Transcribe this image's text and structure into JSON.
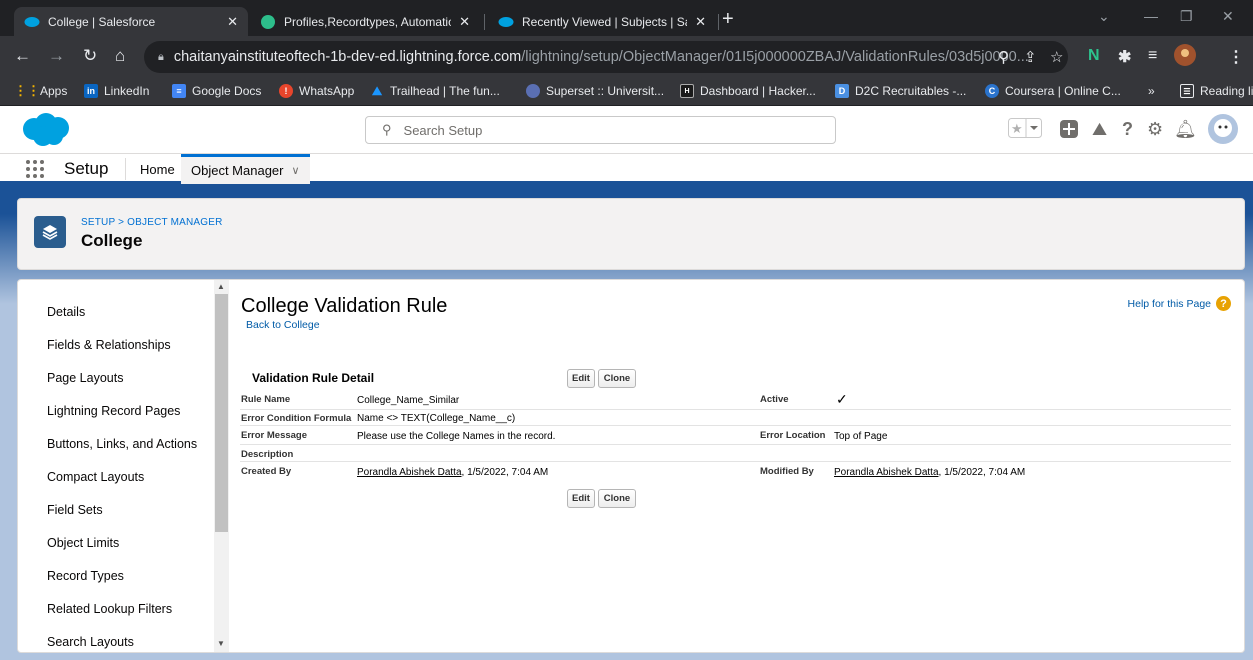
{
  "browser": {
    "tabs": [
      {
        "title": "College | Salesforce",
        "active": true
      },
      {
        "title": "Profiles,Recordtypes, Automation",
        "active": false
      },
      {
        "title": "Recently Viewed | Subjects | Sale",
        "active": false
      }
    ],
    "address": {
      "host": "chaitanyainstituteoftech-1b-dev-ed.lightning.force.com",
      "path": "/lightning/setup/ObjectManager/01I5j000000ZBAJ/ValidationRules/03d5j0000..."
    },
    "bookmarks": [
      {
        "label": "Apps",
        "icon": "apps-grid-icon",
        "color": "#f4b400"
      },
      {
        "label": "LinkedIn",
        "icon": "linkedin-icon",
        "color": "#0a66c2"
      },
      {
        "label": "Google Docs",
        "icon": "google-docs-icon",
        "color": "#4285f4"
      },
      {
        "label": "WhatsApp",
        "icon": "whatsapp-icon",
        "color": "#e8452c"
      },
      {
        "label": "Trailhead | The fun...",
        "icon": "trailhead-icon",
        "color": "#1b96ff"
      },
      {
        "label": "Superset :: Universit...",
        "icon": "superset-icon",
        "color": "#5a6fb3"
      },
      {
        "label": "Dashboard | Hacker...",
        "icon": "hackerrank-icon",
        "color": "#1a1a1a"
      },
      {
        "label": "D2C Recruitables -...",
        "icon": "d2c-icon",
        "color": "#4a90e2"
      },
      {
        "label": "Coursera | Online C...",
        "icon": "coursera-icon",
        "color": "#2a73cc"
      }
    ],
    "bookmarks_more": "»",
    "reading_list": "Reading list"
  },
  "sf_header": {
    "search_placeholder": "Search Setup"
  },
  "sf_nav": {
    "app_name": "Setup",
    "items": [
      {
        "label": "Home"
      },
      {
        "label": "Object Manager",
        "active": true
      }
    ]
  },
  "object_header": {
    "breadcrumb": "SETUP > OBJECT MANAGER",
    "title": "College"
  },
  "sidebar": {
    "items": [
      "Details",
      "Fields & Relationships",
      "Page Layouts",
      "Lightning Record Pages",
      "Buttons, Links, and Actions",
      "Compact Layouts",
      "Field Sets",
      "Object Limits",
      "Record Types",
      "Related Lookup Filters",
      "Search Layouts"
    ]
  },
  "content": {
    "page_title": "College Validation Rule",
    "back_link": "Back to College",
    "help_link": "Help for this Page",
    "section_title": "Validation Rule Detail",
    "edit_label": "Edit",
    "clone_label": "Clone",
    "fields": {
      "rule_name_label": "Rule Name",
      "rule_name_value": "College_Name_Similar",
      "active_label": "Active",
      "active_value": "✓",
      "formula_label": "Error Condition Formula",
      "formula_value": "Name <> TEXT(College_Name__c)",
      "message_label": "Error Message",
      "message_value": "Please use the College Names in the record.",
      "location_label": "Error Location",
      "location_value": "Top of Page",
      "description_label": "Description",
      "description_value": "",
      "created_label": "Created By",
      "created_user": "Porandla Abishek Datta",
      "created_date": ", 1/5/2022, 7:04 AM",
      "modified_label": "Modified By",
      "modified_user": "Porandla Abishek Datta",
      "modified_date": ", 1/5/2022, 7:04 AM"
    }
  }
}
